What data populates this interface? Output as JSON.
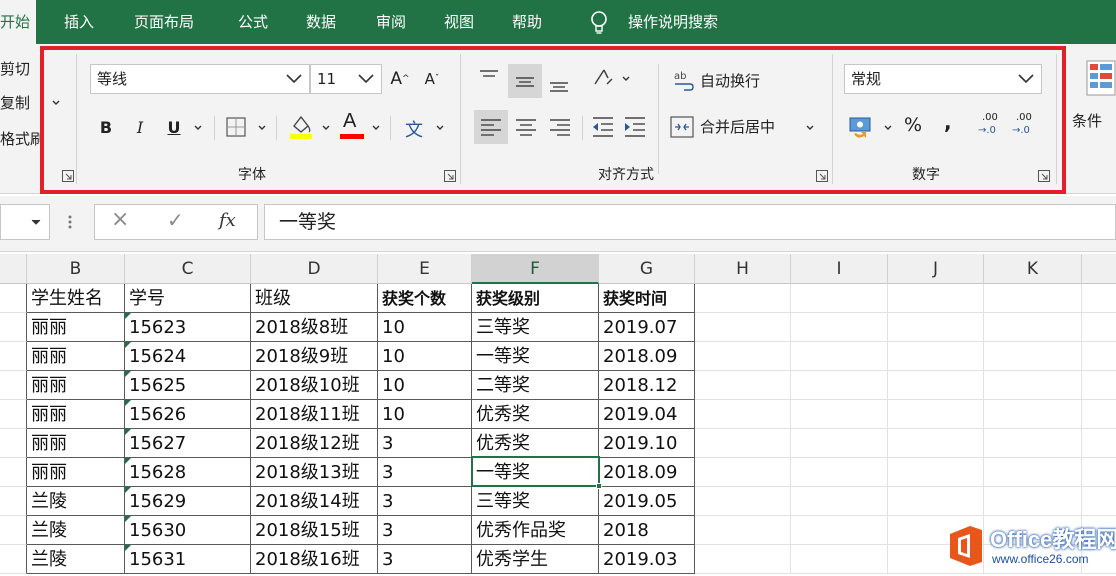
{
  "menu": {
    "tabs": [
      {
        "label": "开始"
      },
      {
        "label": "插入"
      },
      {
        "label": "页面布局"
      },
      {
        "label": "公式"
      },
      {
        "label": "数据"
      },
      {
        "label": "审阅"
      },
      {
        "label": "视图"
      },
      {
        "label": "帮助"
      }
    ],
    "tell_me": "操作说明搜索"
  },
  "clipboard": {
    "cut": "剪切",
    "copy": "复制",
    "format_painter": "格式刷"
  },
  "font_group": {
    "label": "字体",
    "font_name": "等线",
    "font_size": "11",
    "bold": "B",
    "italic": "I",
    "underline": "U",
    "grow": "A",
    "shrink": "A",
    "font_color_letter": "A",
    "phonetic": "文",
    "highlight_color": "#ffff00",
    "font_color": "#ff0000"
  },
  "alignment_group": {
    "label": "对齐方式",
    "wrap_text": "自动换行",
    "merge_center": "合并后居中"
  },
  "number_group": {
    "label": "数字",
    "format": "常规",
    "percent": "%",
    "comma": ",",
    "dec_increase_top": ".00",
    "dec_increase_bottom": "→.0",
    "dec_decrease_top": ".00",
    "dec_decrease_bottom": "→.0"
  },
  "styles": {
    "conditional": "条件"
  },
  "formula_bar": {
    "fx": "fx",
    "cancel": "×",
    "enter": "✓",
    "content": "一等奖"
  },
  "columns": [
    "B",
    "C",
    "D",
    "E",
    "F",
    "G",
    "H",
    "I",
    "J",
    "K"
  ],
  "selected_column": "F",
  "table": {
    "headers": [
      "学生姓名",
      "学号",
      "班级",
      "获奖个数",
      "获奖级别",
      "获奖时间"
    ],
    "rows": [
      [
        "丽丽",
        "15623",
        "2018级8班",
        "10",
        "三等奖",
        "2019.07"
      ],
      [
        "丽丽",
        "15624",
        "2018级9班",
        "10",
        "一等奖",
        "2018.09"
      ],
      [
        "丽丽",
        "15625",
        "2018级10班",
        "10",
        "二等奖",
        "2018.12"
      ],
      [
        "丽丽",
        "15626",
        "2018级11班",
        "10",
        "优秀奖",
        "2019.04"
      ],
      [
        "丽丽",
        "15627",
        "2018级12班",
        "3",
        "优秀奖",
        "2019.10"
      ],
      [
        "丽丽",
        "15628",
        "2018级13班",
        "3",
        "一等奖",
        "2018.09"
      ],
      [
        "兰陵",
        "15629",
        "2018级14班",
        "3",
        "三等奖",
        "2019.05"
      ],
      [
        "兰陵",
        "15630",
        "2018级15班",
        "3",
        "优秀作品奖",
        "2018"
      ],
      [
        "兰陵",
        "15631",
        "2018级16班",
        "3",
        "优秀学生",
        "2019.03"
      ]
    ]
  },
  "watermark": {
    "brand": "Office教程网",
    "url": "www.office26.com"
  },
  "colors": {
    "excel_green": "#217346",
    "highlight_box": "#e0202a"
  }
}
